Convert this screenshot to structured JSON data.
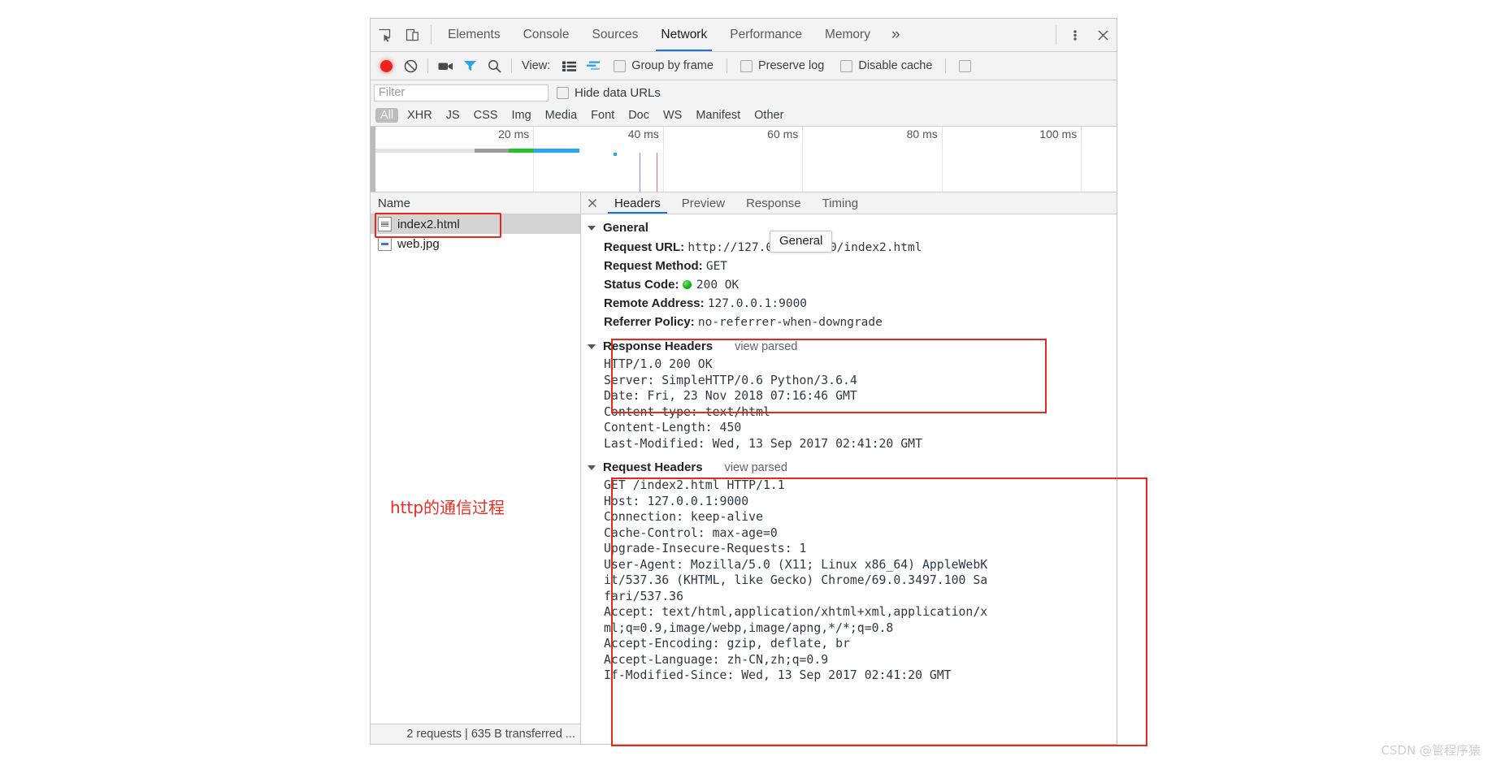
{
  "devtools": {
    "tabstrip": {
      "inspect_icon": "inspect-element-icon",
      "device_icon": "toggle-device-toolbar-icon",
      "tabs": [
        {
          "label": "Elements",
          "active": false
        },
        {
          "label": "Console",
          "active": false
        },
        {
          "label": "Sources",
          "active": false
        },
        {
          "label": "Network",
          "active": true
        },
        {
          "label": "Performance",
          "active": false
        },
        {
          "label": "Memory",
          "active": false
        }
      ],
      "more_label": "»",
      "menu_icon": "kebab-menu-icon",
      "close_icon": "close-icon"
    },
    "toolbar": {
      "record_icon": "record-icon",
      "clear_icon": "clear-icon",
      "capture_screenshots_icon": "camera-icon",
      "filter_icon": "filter-funnel-icon",
      "search_icon": "search-icon",
      "view_label": "View:",
      "list_view_icon": "list-view-icon",
      "waterfall_view_icon": "waterfall-view-icon",
      "group_by_frame_label": "Group by frame",
      "preserve_log_label": "Preserve log",
      "disable_cache_label": "Disable cache",
      "overflow_checkbox_icon": "checkbox-icon"
    },
    "filterbar": {
      "filter_placeholder": "Filter",
      "filter_value": "",
      "hide_data_urls_label": "Hide data URLs"
    },
    "type_filters": [
      {
        "label": "All",
        "active": true
      },
      {
        "label": "XHR",
        "active": false
      },
      {
        "label": "JS",
        "active": false
      },
      {
        "label": "CSS",
        "active": false
      },
      {
        "label": "Img",
        "active": false
      },
      {
        "label": "Media",
        "active": false
      },
      {
        "label": "Font",
        "active": false
      },
      {
        "label": "Doc",
        "active": false
      },
      {
        "label": "WS",
        "active": false
      },
      {
        "label": "Manifest",
        "active": false
      },
      {
        "label": "Other",
        "active": false
      }
    ],
    "overview": {
      "ticks": [
        "20 ms",
        "40 ms",
        "60 ms",
        "80 ms",
        "100 ms"
      ],
      "bar_segments": [
        {
          "color": "#e2e2e2",
          "left_pct": 0.0,
          "width_pct": 13.4
        },
        {
          "color": "#9b9b9b",
          "left_pct": 13.4,
          "width_pct": 4.6
        },
        {
          "color": "#25c32b",
          "left_pct": 18.0,
          "width_pct": 3.4
        },
        {
          "color": "#27a7f5",
          "left_pct": 21.4,
          "width_pct": 6.1
        }
      ],
      "event_lines": [
        {
          "color": "#8b8bf0",
          "left_pct": 35.6
        },
        {
          "color": "#f06a6a",
          "left_pct": 37.9
        }
      ],
      "event_dot": {
        "color": "#27a7f5",
        "left_pct": 32.1
      }
    },
    "request_list": {
      "column_header": "Name",
      "rows": [
        {
          "name": "index2.html",
          "icon": "document-file-icon",
          "selected": true,
          "highlighted": true
        },
        {
          "name": "web.jpg",
          "icon": "image-file-icon",
          "selected": false,
          "highlighted": false
        }
      ],
      "annotation": "http的通信过程",
      "status": "2 requests  |  635 B transferred  ..."
    },
    "detail": {
      "close_icon": "close-icon",
      "tabs": [
        {
          "label": "Headers",
          "active": true
        },
        {
          "label": "Preview",
          "active": false
        },
        {
          "label": "Response",
          "active": false
        },
        {
          "label": "Timing",
          "active": false
        }
      ],
      "tooltip": "General",
      "general": {
        "title": "General",
        "view_parsed": "",
        "rows": [
          {
            "key": "Request URL:",
            "value": "http://127.0.0.1:9000/index2.html",
            "dot": false
          },
          {
            "key": "Request Method:",
            "value": "GET",
            "dot": false
          },
          {
            "key": "Status Code:",
            "value": "200 OK",
            "dot": true
          },
          {
            "key": "Remote Address:",
            "value": "127.0.0.1:9000",
            "dot": false
          },
          {
            "key": "Referrer Policy:",
            "value": "no-referrer-when-downgrade",
            "dot": false
          }
        ]
      },
      "response_headers": {
        "title": "Response Headers",
        "view_parsed": "view parsed",
        "lines": [
          "HTTP/1.0 200 OK",
          "Server: SimpleHTTP/0.6 Python/3.6.4",
          "Date: Fri, 23 Nov 2018 07:16:46 GMT",
          "Content-type: text/html",
          "Content-Length: 450",
          "Last-Modified: Wed, 13 Sep 2017 02:41:20 GMT"
        ]
      },
      "request_headers": {
        "title": "Request Headers",
        "view_parsed": "view parsed",
        "lines": [
          "GET /index2.html HTTP/1.1",
          "Host: 127.0.0.1:9000",
          "Connection: keep-alive",
          "Cache-Control: max-age=0",
          "Upgrade-Insecure-Requests: 1",
          "User-Agent: Mozilla/5.0 (X11; Linux x86_64) AppleWebK",
          "it/537.36 (KHTML, like Gecko) Chrome/69.0.3497.100 Sa",
          "fari/537.36",
          "Accept: text/html,application/xhtml+xml,application/x",
          "ml;q=0.9,image/webp,image/apng,*/*;q=0.8",
          "Accept-Encoding: gzip, deflate, br",
          "Accept-Language: zh-CN,zh;q=0.9",
          "If-Modified-Since: Wed, 13 Sep 2017 02:41:20 GMT"
        ]
      }
    }
  },
  "watermark": "CSDN @管程序猿",
  "colors": {
    "accent": "#1a73e8",
    "highlight_red": "#e8281b",
    "annotation_red": "#ea2d20",
    "status_ok_green": "#17b317",
    "record_red": "#ee2020"
  }
}
